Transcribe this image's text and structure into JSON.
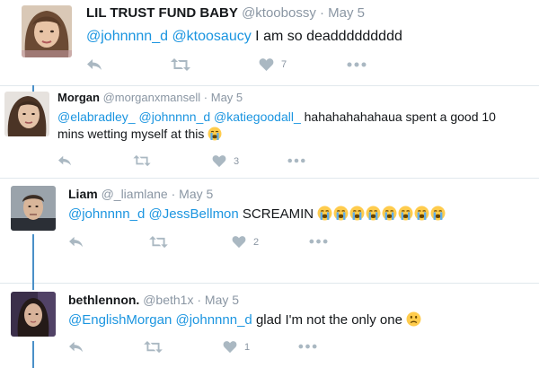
{
  "tweets": [
    {
      "name": "LIL TRUST FUND BABY",
      "handle": "@ktoobossy",
      "separator": "·",
      "date": "May 5",
      "mentions": [
        "@johnnnn_d",
        "@ktoosaucy"
      ],
      "text": "I am so deaddddddddd",
      "likes": "7"
    },
    {
      "name": "Morgan",
      "handle": "@morganxmansell",
      "separator": "·",
      "date": "May 5",
      "mentions": [
        "@elabradley_",
        "@johnnnn_d",
        "@katiegoodall_"
      ],
      "text": "hahahahahahaua spent a good 10",
      "text2": "mins wetting myself at this",
      "emoji": "crying-face",
      "likes": "3"
    },
    {
      "name": "Liam",
      "handle": "@_liamlane",
      "separator": "·",
      "date": "May 5",
      "mentions": [
        "@johnnnn_d",
        "@JessBellmon"
      ],
      "text": "SCREAMIN",
      "emoji": "crying-face",
      "emoji_count": 8,
      "likes": "2"
    },
    {
      "name": "bethlennon.",
      "handle": "@beth1x",
      "separator": "·",
      "date": "May 5",
      "mentions": [
        "@EnglishMorgan",
        "@johnnnn_d"
      ],
      "text": "glad I'm not the only one",
      "emoji": "slightly-frowning-face",
      "likes": "1"
    }
  ],
  "icons": {
    "reply": "reply-icon",
    "retweet": "retweet-icon",
    "like": "heart-icon",
    "more": "more-icon"
  },
  "colors": {
    "mention": "#1b95e0",
    "thread_line": "#4a90c8",
    "action_gray": "#aab8c2",
    "secondary_text": "#8a96a3"
  }
}
